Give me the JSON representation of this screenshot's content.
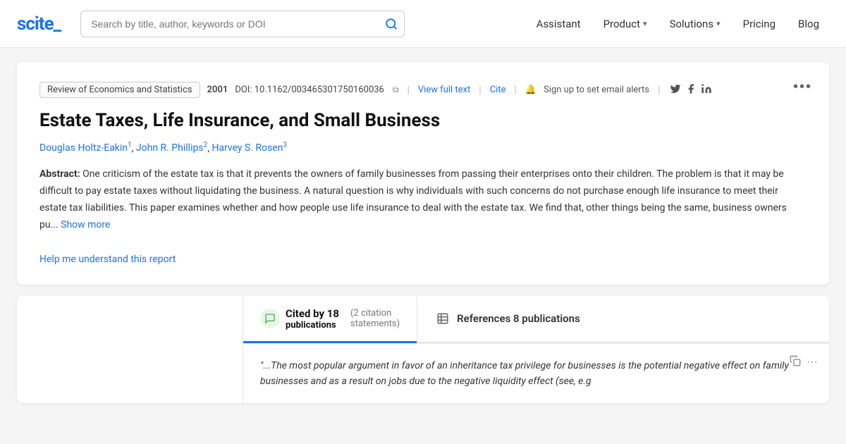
{
  "navbar": {
    "logo": "scite_",
    "search_placeholder": "Search by title, author, keywords or DOI",
    "nav_items": [
      {
        "label": "Assistant",
        "has_dropdown": false
      },
      {
        "label": "Product",
        "has_dropdown": true
      },
      {
        "label": "Solutions",
        "has_dropdown": true
      },
      {
        "label": "Pricing",
        "has_dropdown": false
      },
      {
        "label": "Blog",
        "has_dropdown": false
      }
    ]
  },
  "paper": {
    "journal": "Review of Economics and Statistics",
    "year": "2001",
    "doi_prefix": "DOI: ",
    "doi": "10.1162/003465301750160036",
    "view_full_text": "View full text",
    "cite": "Cite",
    "alert_text": "Sign up to set email alerts",
    "title": "Estate Taxes, Life Insurance, and Small Business",
    "authors": [
      {
        "name": "Douglas Holtz-Eakin",
        "sup": "1"
      },
      {
        "name": "John R. Phillips",
        "sup": "2"
      },
      {
        "name": "Harvey S. Rosen",
        "sup": "3"
      }
    ],
    "abstract_label": "Abstract:",
    "abstract_text": "One criticism of the estate tax is that it prevents the owners of family businesses from passing their enterprises onto their children. The problem is that it may be difficult to pay estate taxes without liquidating the business. A natural question is why individuals with such concerns do not purchase enough life insurance to meet their estate tax liabilities. This paper examines whether and how people use life insurance to deal with the estate tax. We find that, other things being the same, business owners pu...",
    "show_more": "Show more",
    "help_link": "Help me understand this report",
    "more_dots": "•••"
  },
  "citations": {
    "cited_by_label": "Cited by 18",
    "cited_by_sub": "publications",
    "citation_statements": "(2 citation",
    "citation_statements2": "statements)",
    "references_label": "References 8 publications",
    "tab_icon": "💬",
    "ref_icon": "📋",
    "quote_text": "\"...The most popular argument in favor of an inheritance tax privilege for businesses is the potential negative effect on family businesses and as a result on jobs due to the negative liquidity effect (see, e.g"
  },
  "icons": {
    "search": "🔍",
    "twitter": "🐦",
    "facebook": "f",
    "linkedin": "in",
    "bell": "🔔",
    "copy": "⧉",
    "more": "···",
    "quote_copy": "⧉",
    "quote_more": "···"
  }
}
